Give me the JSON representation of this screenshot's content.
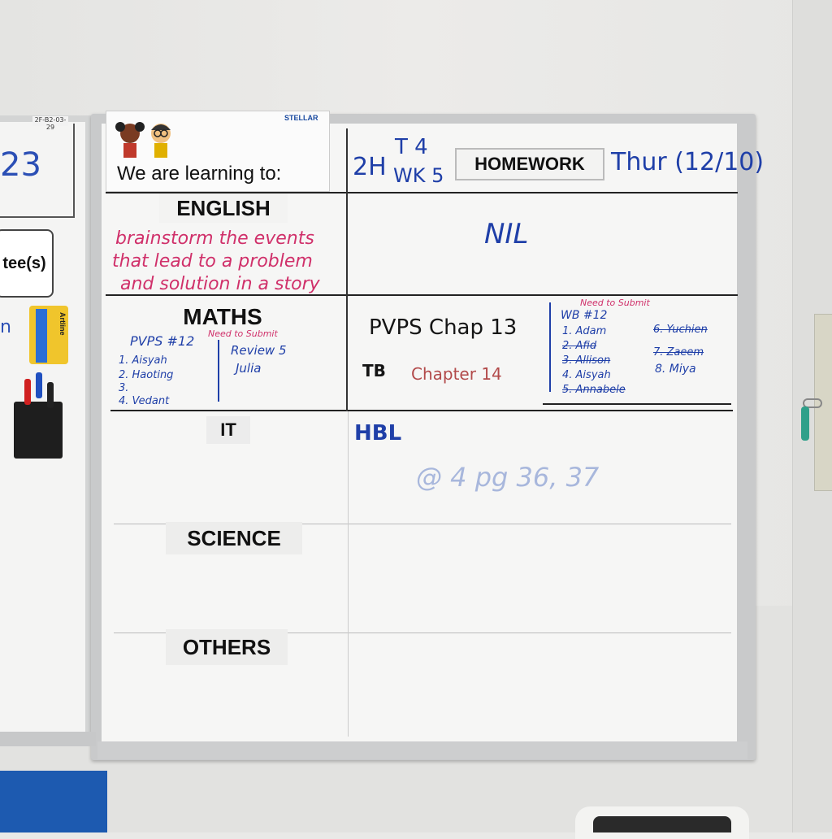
{
  "left_board": {
    "number": "23",
    "tee_label": "tee(s)",
    "tag": "2F-B2-03-29",
    "eraser_brand": "Artline"
  },
  "header": {
    "brand": "STELLAR",
    "learning_title": "We are learning to:",
    "class_code": "2H",
    "term": "T 4",
    "week": "WK 5",
    "homework_label": "HOMEWORK",
    "date": "Thur (12/10)"
  },
  "subjects": {
    "english": {
      "label": "ENGLISH",
      "objective_lines": [
        "brainstorm the events",
        "that lead to a problem",
        "and solution in a story"
      ],
      "homework": "NIL"
    },
    "maths": {
      "label": "MATHS",
      "need_submit_note": "Need to Submit",
      "pvps_title": "PVPS #12",
      "pvps_list": [
        "1. Aisyah",
        "2. Haoting",
        "3.",
        "4. Vedant"
      ],
      "review_title": "Review 5",
      "review_list": [
        "Julia"
      ],
      "homework_line1": "PVPS Chap 13",
      "homework_tb_prefix": "TB",
      "homework_tb_text": "Chapter 14",
      "wb_title": "WB #12",
      "wb_note": "Need to Submit",
      "wb_list_left": [
        "1. Adam",
        "2. Afid",
        "3. Allison",
        "4. Aisyah",
        "5. Annabele"
      ],
      "wb_list_right": [
        "6. Yuchien",
        "7. Zaeem",
        "8. Miya"
      ]
    },
    "it": {
      "label": "IT",
      "homework_title": "HBL",
      "homework_note": "@ 4 pg 36, 37"
    },
    "science": {
      "label": "SCIENCE"
    },
    "others": {
      "label": "OTHERS"
    }
  },
  "colors": {
    "blue_marker": "#1f3fa8",
    "red_marker": "#d0306a",
    "black_marker": "#151515"
  }
}
